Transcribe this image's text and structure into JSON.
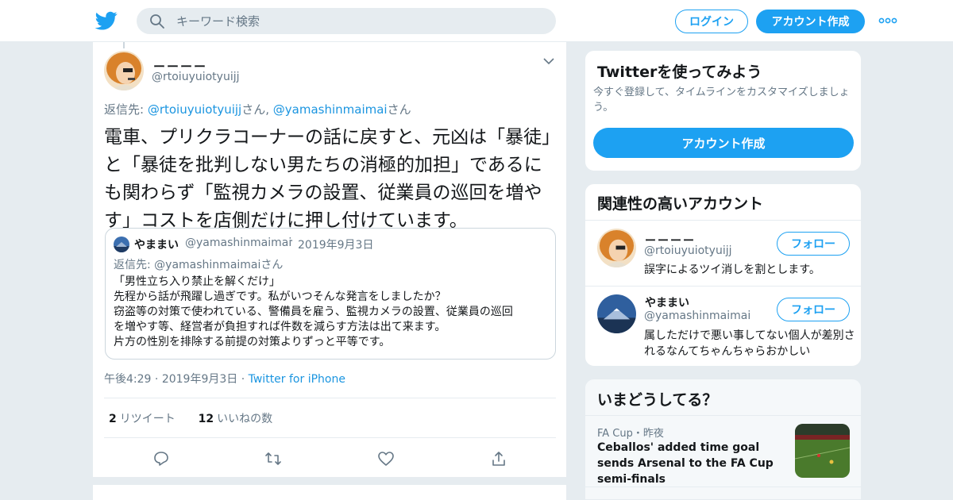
{
  "header": {
    "logo_icon": "twitter-bird-icon",
    "search_placeholder": "キーワード検索",
    "login_label": "ログイン",
    "signup_label": "アカウント作成",
    "brand_color": "#1da1f2"
  },
  "tweet": {
    "display_name": "ーーーー",
    "handle": "@rtoiuyuiotyuijj",
    "reply_prefix": "返信先: ",
    "reply_user1": "@rtoiuyuiotyuijj",
    "reply_mid": "さん, ",
    "reply_user2": "@yamashinmaimai",
    "reply_suffix": "さん",
    "text": "電車、プリクラコーナーの話に戻すと、元凶は「暴徒」と「暴徒を批判しない男たちの消極的加担」であるにも関わらず「監視カメラの設置、従業員の巡回を増やす」コストを店側だけに押し付けています。",
    "quote": {
      "name": "やままい",
      "handle": "@yamashinmaimai",
      "date": "2019年9月3日",
      "reply": "返信先: @yamashinmaimaiさん",
      "body_lines": [
        "「男性立ち入り禁止を解くだけ」",
        "先程から話が飛躍し過ぎです。私がいつそんな発言をしましたか？",
        "窃盗等の対策で使われている、警備員を雇う、監視カメラの設置、従業員の巡回",
        "を増やす等、経営者が負担すれば件数を減らす方法は出て来ます。",
        "片方の性別を排除する前提の対策よりずっと平等です。"
      ]
    },
    "time": "午後4:29",
    "date": "2019年9月3日",
    "client": "Twitter for iPhone",
    "retweet_count": "2",
    "retweet_label": "リツイート",
    "like_count": "12",
    "like_label": "いいねの数",
    "action_icons": [
      "reply-icon",
      "retweet-icon",
      "like-icon",
      "share-icon"
    ]
  },
  "signup_card": {
    "title": "Twitterを使ってみよう",
    "desc": "今すぐ登録して、タイムラインをカスタマイズしましょう。",
    "button": "アカウント作成"
  },
  "related": {
    "title": "関連性の高いアカウント",
    "follow_label": "フォロー",
    "accounts": [
      {
        "name": "ーーーー",
        "handle": "@rtoiuyuiotyuijj",
        "bio": "誤字によるツイ消しを割とします。"
      },
      {
        "name": "やままい",
        "handle": "@yamashinmaimai",
        "bio": "属しただけで悪い事してない個人が差別されるなんてちゃんちゃらおかしい"
      }
    ]
  },
  "trends": {
    "title": "いまどうしてる？",
    "meta": "FA Cup・昨夜",
    "headline": "Ceballos' added time goal sends Arsenal to the FA Cup semi-finals"
  }
}
